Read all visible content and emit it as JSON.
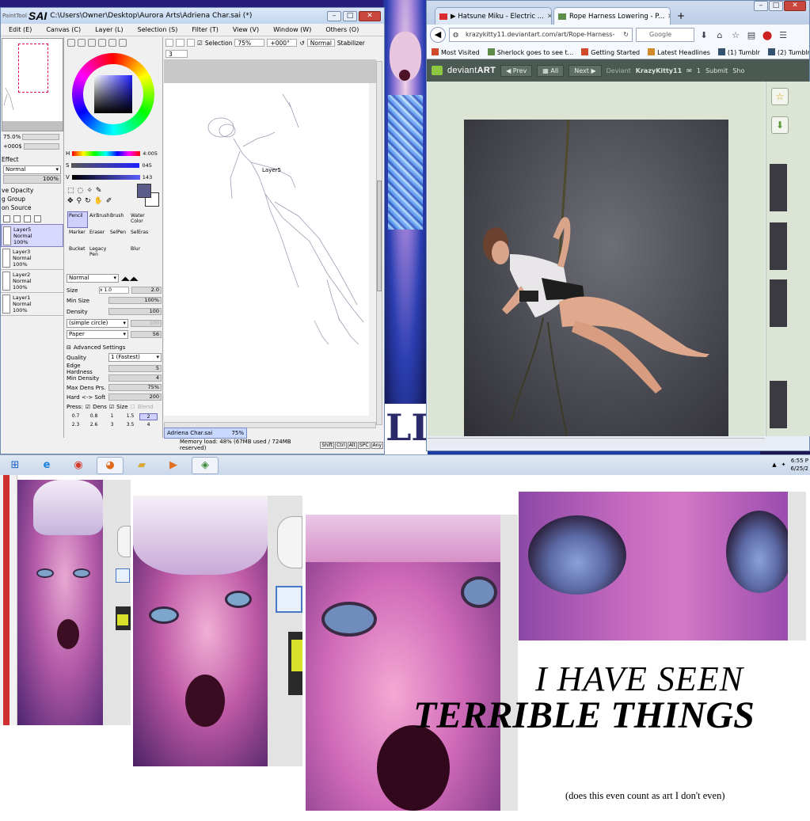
{
  "sai": {
    "title_logo": "SAI",
    "title_logo_small": "PaintTool",
    "title": "C:\\Users\\Owner\\Desktop\\Aurora Arts\\Adriena Char.sai (*)",
    "menu": [
      "Edit (E)",
      "Canvas (C)",
      "Layer (L)",
      "Selection (S)",
      "Filter (T)",
      "View (V)",
      "Window (W)",
      "Others (O)"
    ],
    "navigator": {
      "zoom": "75.0%",
      "angle": "+000$"
    },
    "effect_label": "Effect",
    "blend_mode": "Normal",
    "opacity": "100%",
    "options": [
      "ve Opacity",
      "g Group",
      "on Source"
    ],
    "layers": [
      {
        "name": "Layer5",
        "mode": "Normal",
        "opacity": "100%",
        "active": true
      },
      {
        "name": "Layer3",
        "mode": "Normal",
        "opacity": "100%",
        "active": false
      },
      {
        "name": "Layer2",
        "mode": "Normal",
        "opacity": "100%",
        "active": false
      },
      {
        "name": "Layer1",
        "mode": "Normal",
        "opacity": "100%",
        "active": false
      }
    ],
    "color": {
      "H": "4:005",
      "S": "045",
      "V": "143",
      "main_color": "#5c5c8a"
    },
    "brushes": [
      {
        "label": "Pencil",
        "active": true
      },
      {
        "label": "AirBrush",
        "active": false
      },
      {
        "label": "Brush",
        "active": false
      },
      {
        "label": "Water Color",
        "active": false
      },
      {
        "label": "Marker",
        "active": false
      },
      {
        "label": "Eraser",
        "active": false
      },
      {
        "label": "SelPen",
        "active": false
      },
      {
        "label": "SelEras",
        "active": false
      },
      {
        "label": "Bucket",
        "active": false
      },
      {
        "label": "Legacy Pen",
        "active": false
      },
      {
        "label": "",
        "active": false
      },
      {
        "label": "Blur",
        "active": false
      }
    ],
    "brush_mode": "Normal",
    "size": {
      "label": "Size",
      "mult": "x 1.0",
      "value": "2.0"
    },
    "min_size": {
      "label": "Min Size",
      "value": "100%"
    },
    "density": {
      "label": "Density",
      "value": "100"
    },
    "shape": "(simple circle)",
    "shape_value": "100",
    "texture": "Paper",
    "texture_value": "56",
    "advanced": "Advanced Settings",
    "quality": {
      "label": "Quality",
      "value": "1 (Fastest)"
    },
    "edge_hardness": {
      "label": "Edge Hardness",
      "value": "5"
    },
    "min_density": {
      "label": "Min Density",
      "value": "4"
    },
    "max_dens_prs": {
      "label": "Max Dens Prs.",
      "value": "75%"
    },
    "hard_soft": {
      "label": "Hard <-> Soft",
      "value": "200"
    },
    "press": {
      "label": "Press:",
      "dens": "Dens",
      "size": "Size",
      "blend": "Blend"
    },
    "dot_sizes": [
      "0.7",
      "0.8",
      "1",
      "1.5",
      "2",
      "2.3",
      "2.6",
      "3",
      "3.5",
      "4"
    ],
    "canvas_toolbar": {
      "selection": "Selection",
      "zoom": "75%",
      "angle": "+000°",
      "mode": "Normal",
      "stabilizer_label": "Stabilizer",
      "stabilizer": "3"
    },
    "canvas_layer_label": "Layer5",
    "doc_tab": {
      "name": "Adriena Char.sai",
      "zoom": "75%"
    },
    "status": "Memory load: 48% (67MB used / 724MB reserved)",
    "keys": [
      "Shift",
      "Ctrl",
      "Alt",
      "SPC",
      "Any"
    ]
  },
  "firefox": {
    "tabs": [
      {
        "title": "▶ Hatsune Miku - Electric ...",
        "active": false,
        "favicon_color": "#d92b2b"
      },
      {
        "title": "Rope Harness Lowering - P...",
        "active": true,
        "favicon_color": "#5e8d4a"
      }
    ],
    "new_tab": "+",
    "url": "krazykitty11.deviantart.com/art/Rope-Harness-",
    "search_placeholder": "Google",
    "bookmarks": [
      {
        "label": "Most Visited",
        "color": "#d04a2a"
      },
      {
        "label": "Sherlock goes to see t...",
        "color": "#5e8d4a"
      },
      {
        "label": "Getting Started",
        "color": "#d04a2a"
      },
      {
        "label": "Latest Headlines",
        "color": "#d08a2a"
      },
      {
        "label": "(1) Tumblr",
        "color": "#34526f"
      },
      {
        "label": "(2) Tumblr",
        "color": "#34526f"
      }
    ],
    "da": {
      "logo_light": "deviant",
      "logo_bold": "ART",
      "prev": "Prev",
      "all": "All",
      "next": "Next",
      "deviant_label": "Deviant",
      "deviant_name": "KrazyKitty11",
      "notes": "1",
      "submit": "Submit",
      "shop": "Sho"
    }
  },
  "taskbar": {
    "items": [
      "windows-start-icon",
      "internet-explorer-icon",
      "chrome-icon",
      "firefox-icon",
      "file-explorer-icon",
      "media-player-icon",
      "sai-app-icon"
    ],
    "time": "6:55 P",
    "date": "6/25/2"
  },
  "meme": {
    "line1": "I HAVE SEEN",
    "line2": "TERRIBLE THINGS",
    "note": "(does this even count as art I don't even)"
  }
}
